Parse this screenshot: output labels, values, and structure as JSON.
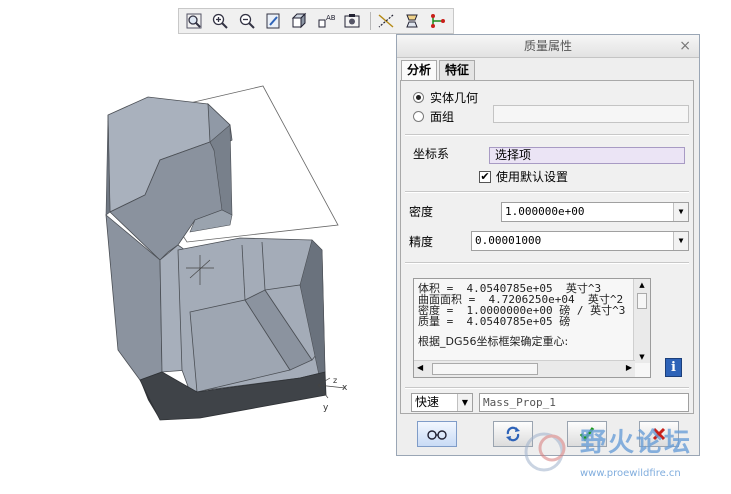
{
  "toolbar": {
    "icons": [
      "refit-icon",
      "zoom-in-icon",
      "zoom-out-icon",
      "repaint-icon",
      "shading-icon",
      "view-manager-icon",
      "saved-views-icon",
      "datum-planes-icon",
      "datum-axes-icon",
      "datum-points-icon"
    ]
  },
  "dialog": {
    "title": "质量属性",
    "close": "×",
    "tabs": [
      "分析",
      "特征"
    ],
    "radio_solid": "实体几何",
    "radio_quilt": "面组",
    "coord_label": "坐标系",
    "coord_value": "选择项",
    "default_setting": "使用默认设置",
    "density_label": "密度",
    "density_value": "1.000000e+00",
    "precision_label": "精度",
    "precision_value": "0.00001000",
    "results": [
      "体积 =  4.0540785e+05  英寸^3",
      "曲面面积 =  4.7206250e+04  英寸^2",
      "密度 =  1.0000000e+00 磅 / 英寸^3",
      "质量 =  4.0540785e+05 磅",
      "",
      "根据_DG56坐标框架确定重心:"
    ],
    "mode_value": "快速",
    "name_value": "Mass_Prop_1"
  },
  "viewport": {
    "axis_x": "x",
    "axis_y": "y",
    "axis_z": "z"
  },
  "watermark": {
    "brand": "野火论坛",
    "url": "www.proewildfire.cn"
  },
  "colors": {
    "accent": "#2e63b8",
    "ok_green": "#1a9a1a",
    "cancel_red": "#c8201a",
    "model_light": "#a8b0bc",
    "model_dark": "#3f4348"
  }
}
